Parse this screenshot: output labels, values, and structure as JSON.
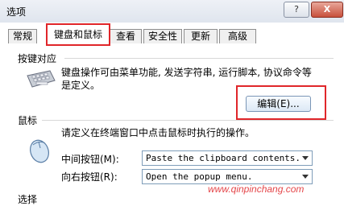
{
  "window": {
    "title": "选项",
    "help_label": "?",
    "close_label": "X"
  },
  "tabs": [
    {
      "label": "常规"
    },
    {
      "label": "键盘和鼠标"
    },
    {
      "label": "查看"
    },
    {
      "label": "安全性"
    },
    {
      "label": "更新"
    },
    {
      "label": "高级"
    }
  ],
  "keyboard_section": {
    "heading": "按键对应",
    "description": "键盘操作可由菜单功能, 发送字符串, 运行脚本, 协议命令等是定义。",
    "edit_button": "编辑(E)...",
    "icon": "keyboard-icon"
  },
  "mouse_section": {
    "heading": "鼠标",
    "description": "请定义在终端窗口中点击鼠标时执行的操作。",
    "icon": "mouse-icon",
    "middle_label": "中间按钮(M):",
    "middle_value": "Paste the clipboard contents.",
    "right_label": "向右按钮(R):",
    "right_value": "Open the popup menu."
  },
  "next_section": {
    "heading": "选择"
  },
  "watermark": "www.qinpinchang.com",
  "colors": {
    "highlight": "#e0262a",
    "tab_border": "#8d8d8d"
  }
}
